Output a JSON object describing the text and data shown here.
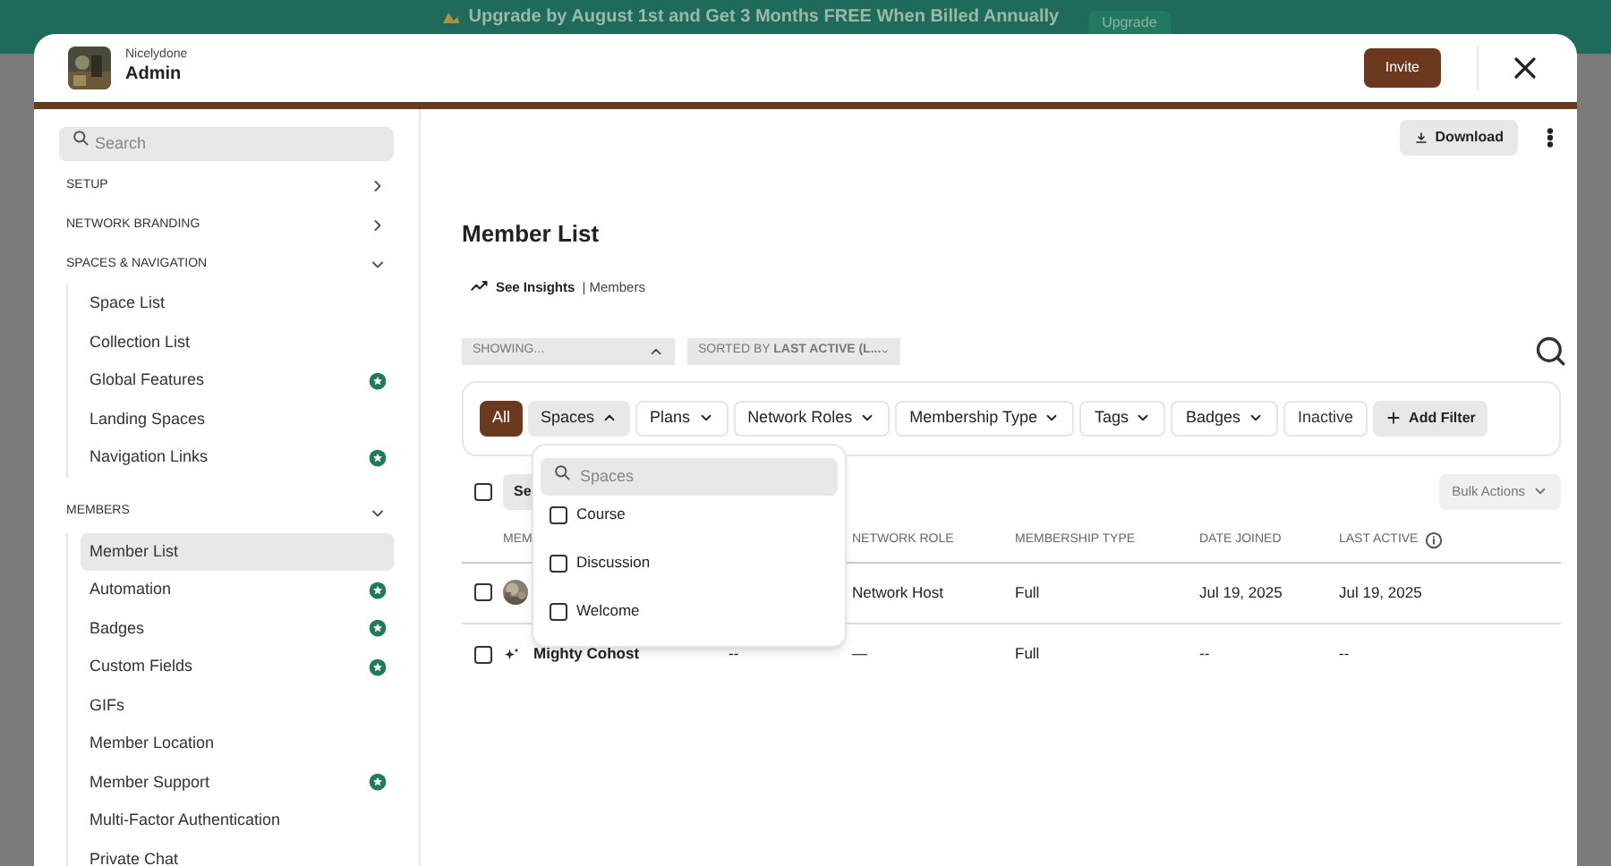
{
  "banner": {
    "text": "Upgrade by August 1st and Get 3 Months FREE When Billed Annually",
    "button": "Upgrade"
  },
  "header": {
    "network": "Nicelydone",
    "title": "Admin",
    "invite": "Invite"
  },
  "sidebar": {
    "search": {
      "placeholder": "Search"
    },
    "sections": [
      {
        "label": "SETUP",
        "expanded": false
      },
      {
        "label": "NETWORK BRANDING",
        "expanded": false
      },
      {
        "label": "SPACES & NAVIGATION",
        "expanded": true,
        "items": [
          {
            "label": "Space List",
            "starred": false,
            "selected": false
          },
          {
            "label": "Collection List",
            "starred": false,
            "selected": false
          },
          {
            "label": "Global Features",
            "starred": true,
            "selected": false
          },
          {
            "label": "Landing Spaces",
            "starred": false,
            "selected": false
          },
          {
            "label": "Navigation Links",
            "starred": true,
            "selected": false
          }
        ]
      },
      {
        "label": "MEMBERS",
        "expanded": true,
        "items": [
          {
            "label": "Member List",
            "starred": false,
            "selected": true
          },
          {
            "label": "Automation",
            "starred": true,
            "selected": false
          },
          {
            "label": "Badges",
            "starred": true,
            "selected": false
          },
          {
            "label": "Custom Fields",
            "starred": true,
            "selected": false
          },
          {
            "label": "GIFs",
            "starred": false,
            "selected": false
          },
          {
            "label": "Member Location",
            "starred": false,
            "selected": false
          },
          {
            "label": "Member Support",
            "starred": true,
            "selected": false
          },
          {
            "label": "Multi-Factor Authentication",
            "starred": false,
            "selected": false
          },
          {
            "label": "Private Chat",
            "starred": false,
            "selected": false
          }
        ]
      }
    ]
  },
  "toolbar": {
    "download": "Download"
  },
  "page": {
    "title": "Member List",
    "insights": "See Insights",
    "insights_suffix": "| Members"
  },
  "selects": [
    {
      "label": "SHOWING...",
      "expanded": true
    },
    {
      "label": "SORTED BY **LAST ACTIVE (L...**",
      "expanded": false
    }
  ],
  "filters": [
    {
      "label": "All",
      "kind": "pill",
      "selected": true
    },
    {
      "label": "Spaces",
      "kind": "dropdown",
      "expanded": true
    },
    {
      "label": "Plans",
      "kind": "dropdown",
      "expanded": false
    },
    {
      "label": "Network Roles",
      "kind": "dropdown",
      "expanded": false
    },
    {
      "label": "Membership Type",
      "kind": "dropdown",
      "expanded": false
    },
    {
      "label": "Tags",
      "kind": "dropdown",
      "expanded": false
    },
    {
      "label": "Badges",
      "kind": "dropdown",
      "expanded": false
    },
    {
      "label": "Inactive",
      "kind": "pill",
      "selected": false
    },
    {
      "label": "Add Filter",
      "kind": "add"
    }
  ],
  "dropdown": {
    "placeholder": "Spaces",
    "options": [
      {
        "label": "Course",
        "checked": false
      },
      {
        "label": "Discussion",
        "checked": false
      },
      {
        "label": "Welcome",
        "checked": false
      }
    ]
  },
  "table": {
    "select_all": false,
    "select_button": "Se",
    "bulk_actions": "Bulk Actions",
    "columns": [
      "MEM",
      "",
      "NETWORK ROLE",
      "MEMBERSHIP TYPE",
      "DATE JOINED",
      "LAST ACTIVE"
    ],
    "rows": [
      {
        "checked": false,
        "cells": [
          "",
          "",
          "Network Host",
          "Full",
          "Jul 19, 2025",
          "Jul 19, 2025"
        ]
      },
      {
        "checked": false,
        "kind": "sparkle",
        "cells": [
          "Mighty Cohost",
          "--",
          "—",
          "Full",
          "--",
          "--"
        ]
      }
    ]
  }
}
